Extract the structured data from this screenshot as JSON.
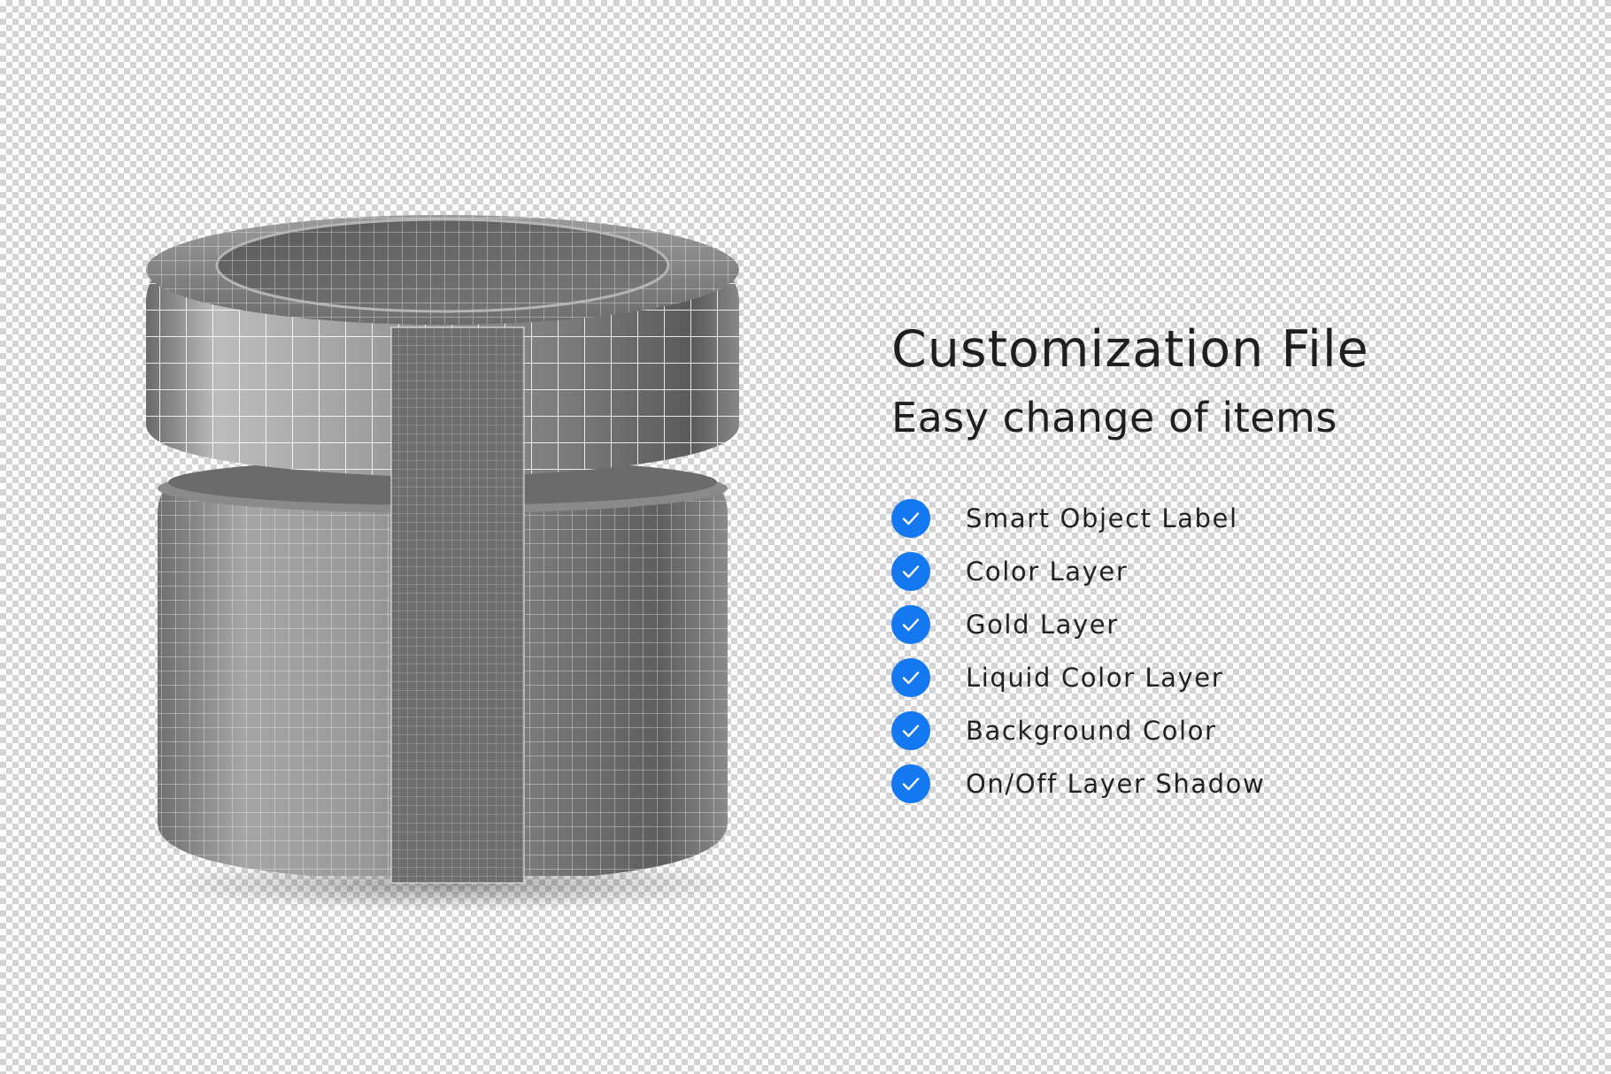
{
  "heading": {
    "title": "Customization File",
    "subtitle": "Easy change of items"
  },
  "features": [
    {
      "label": "Smart Object Label",
      "icon": "check-circle-icon"
    },
    {
      "label": "Color Layer",
      "icon": "check-circle-icon"
    },
    {
      "label": "Gold Layer",
      "icon": "check-circle-icon"
    },
    {
      "label": "Liquid Color Layer",
      "icon": "check-circle-icon"
    },
    {
      "label": "Background Color",
      "icon": "check-circle-icon"
    },
    {
      "label": "On/Off Layer Shadow",
      "icon": "check-circle-icon"
    }
  ],
  "colors": {
    "accent": "#1478f0",
    "text": "#1f1f1f",
    "checker_light": "#ffffff",
    "checker_dark": "#d4d4d4"
  }
}
